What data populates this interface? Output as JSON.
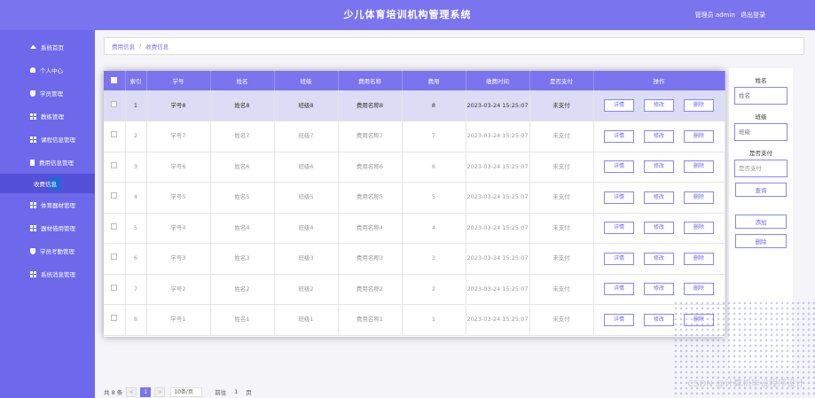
{
  "header": {
    "title": "少儿体育培训机构管理系统",
    "user_label": "管理员 admin",
    "logout": "退出登录"
  },
  "sidebar": {
    "items": [
      {
        "label": "系统首页",
        "icon": "home-icon"
      },
      {
        "label": "个人中心",
        "icon": "user-icon"
      },
      {
        "label": "学员管理",
        "icon": "shield-icon"
      },
      {
        "label": "教练管理",
        "icon": "grid-icon"
      },
      {
        "label": "课程信息管理",
        "icon": "grid-icon"
      },
      {
        "label": "费用信息管理",
        "icon": "doc-icon"
      },
      {
        "label": "收费信息",
        "icon": ""
      },
      {
        "label": "体育器材管理",
        "icon": "grid-icon"
      },
      {
        "label": "器材借用管理",
        "icon": "grid-icon"
      },
      {
        "label": "学员考勤管理",
        "icon": "shield-icon"
      },
      {
        "label": "系统消息管理",
        "icon": "grid-icon"
      }
    ]
  },
  "breadcrumb": {
    "home": "费用信息",
    "current": "收费信息"
  },
  "table": {
    "headers": [
      "索引",
      "学号",
      "姓名",
      "班级",
      "费用名称",
      "费用",
      "缴费时间",
      "是否支付",
      "操作"
    ],
    "buttons": {
      "detail": "详情",
      "edit": "修改",
      "delete": "删除"
    },
    "rows": [
      {
        "idx": "1",
        "student_no": "学号8",
        "name": "姓名8",
        "class": "班级8",
        "fee_name": "费用名称8",
        "fee": "8",
        "time": "2023-03-24 15:25:07",
        "paid": "未支付"
      },
      {
        "idx": "2",
        "student_no": "学号7",
        "name": "姓名7",
        "class": "班级7",
        "fee_name": "费用名称7",
        "fee": "7",
        "time": "2023-03-24 15:25:07",
        "paid": "未支付"
      },
      {
        "idx": "3",
        "student_no": "学号6",
        "name": "姓名6",
        "class": "班级6",
        "fee_name": "费用名称6",
        "fee": "6",
        "time": "2023-03-24 15:25:07",
        "paid": "未支付"
      },
      {
        "idx": "4",
        "student_no": "学号5",
        "name": "姓名5",
        "class": "班级5",
        "fee_name": "费用名称5",
        "fee": "5",
        "time": "2023-03-24 15:25:07",
        "paid": "未支付"
      },
      {
        "idx": "5",
        "student_no": "学号4",
        "name": "姓名4",
        "class": "班级4",
        "fee_name": "费用名称4",
        "fee": "4",
        "time": "2023-03-24 15:25:07",
        "paid": "未支付"
      },
      {
        "idx": "6",
        "student_no": "学号3",
        "name": "姓名3",
        "class": "班级3",
        "fee_name": "费用名称3",
        "fee": "3",
        "time": "2023-03-24 15:25:07",
        "paid": "未支付"
      },
      {
        "idx": "7",
        "student_no": "学号2",
        "name": "姓名2",
        "class": "班级2",
        "fee_name": "费用名称2",
        "fee": "2",
        "time": "2023-03-24 15:25:07",
        "paid": "未支付"
      },
      {
        "idx": "8",
        "student_no": "学号1",
        "name": "姓名1",
        "class": "班级1",
        "fee_name": "费用名称1",
        "fee": "1",
        "time": "2023-03-24 15:25:07",
        "paid": "未支付"
      }
    ]
  },
  "search": {
    "name_label": "姓名",
    "name_placeholder": "姓名",
    "class_label": "班级",
    "class_placeholder": "班级",
    "paid_label": "是否支付",
    "paid_value": "是否支付",
    "query_btn": "查询",
    "add_btn": "添加",
    "delete_btn": "删除"
  },
  "pager": {
    "total": "共 8 条",
    "prev": "<",
    "page": "1",
    "next": ">",
    "per_page": "10条/页",
    "goto_label": "前往",
    "goto_value": "1",
    "goto_suffix": "页"
  },
  "watermark": "CSDN @计算机毕设程序设计",
  "colors": {
    "primary": "#7a74ee",
    "sidebar": "#6e69ea"
  }
}
